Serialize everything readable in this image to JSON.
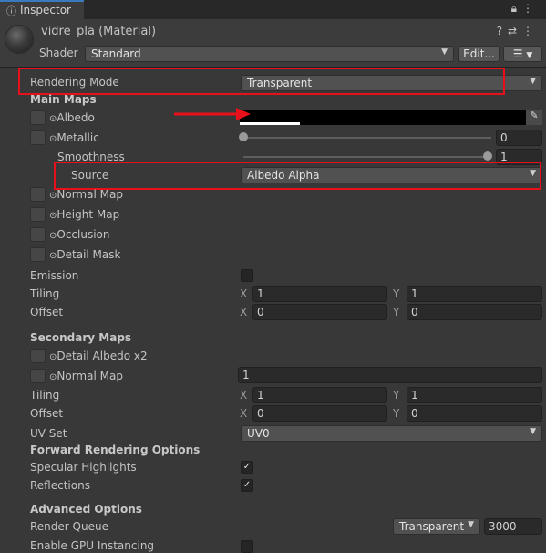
{
  "tab": {
    "icon": "info-icon",
    "label": "Inspector"
  },
  "tab_icons": {
    "lock": "lock-icon",
    "menu": "more-icon"
  },
  "header": {
    "material_name": "vidre_pla (Material)",
    "shader_label": "Shader",
    "shader_value": "Standard",
    "edit_label": "Edit...",
    "header_icons": [
      "help-icon",
      "settings-icon",
      "more-icon"
    ]
  },
  "rendering_mode": {
    "label": "Rendering Mode",
    "value": "Transparent"
  },
  "main_maps": {
    "title": "Main Maps",
    "albedo": "Albedo",
    "metallic": {
      "label": "Metallic",
      "value": "0",
      "level": 0
    },
    "smoothness": {
      "label": "Smoothness",
      "value": "1",
      "level": 1
    },
    "source": {
      "label": "Source",
      "value": "Albedo Alpha"
    },
    "normal_map": "Normal Map",
    "height_map": "Height Map",
    "occlusion": "Occlusion",
    "detail_mask": "Detail Mask",
    "emission": "Emission",
    "tiling": {
      "label": "Tiling",
      "x_label": "X",
      "x": "1",
      "y_label": "Y",
      "y": "1"
    },
    "offset": {
      "label": "Offset",
      "x_label": "X",
      "x": "0",
      "y_label": "Y",
      "y": "0"
    }
  },
  "secondary_maps": {
    "title": "Secondary Maps",
    "detail_albedo": "Detail Albedo x2",
    "normal_map": "Normal Map",
    "normal_value": "1",
    "tiling": {
      "label": "Tiling",
      "x_label": "X",
      "x": "1",
      "y_label": "Y",
      "y": "1"
    },
    "offset": {
      "label": "Offset",
      "x_label": "X",
      "x": "0",
      "y_label": "Y",
      "y": "0"
    },
    "uv_set": {
      "label": "UV Set",
      "value": "UV0"
    }
  },
  "forward_options": {
    "title": "Forward Rendering Options",
    "specular": {
      "label": "Specular Highlights",
      "checked": true
    },
    "reflections": {
      "label": "Reflections",
      "checked": true
    }
  },
  "advanced_options": {
    "title": "Advanced Options",
    "render_queue": {
      "label": "Render Queue",
      "mode": "Transparent",
      "value": "3000"
    },
    "gpu_instancing": {
      "label": "Enable GPU Instancing",
      "checked": false
    }
  },
  "colors": {
    "highlight": "#e8101a",
    "albedo_swatch": "#000000",
    "accent": "#3a79bb"
  },
  "check_glyph": "✓",
  "arrow_glyph": "▾"
}
